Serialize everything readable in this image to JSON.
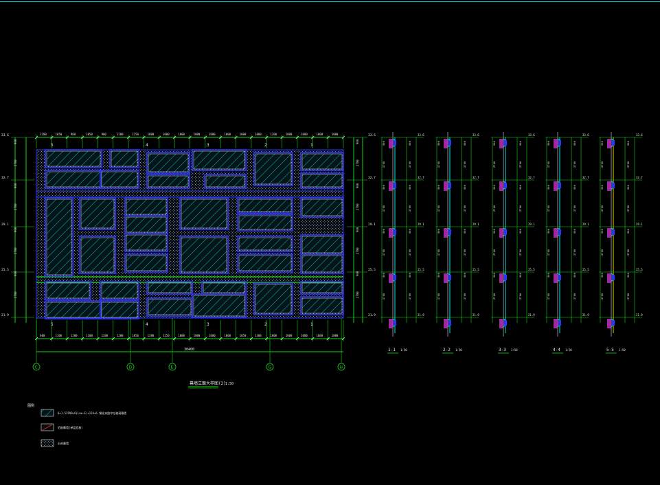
{
  "drawing": {
    "main_title": "幕墙立面大样图(2)",
    "main_scale": "1:50",
    "axes": [
      "C",
      "D",
      "E",
      "G",
      "H"
    ],
    "panel_marks_top": [
      "5",
      "4",
      "3",
      "2",
      "1"
    ],
    "panel_marks_bottom": [
      "5",
      "4",
      "3",
      "2",
      "1"
    ],
    "top_dims": [
      "1200",
      "1050",
      "900",
      "1050",
      "900",
      "1200",
      "1250",
      "1000",
      "1000",
      "1000",
      "1000",
      "1000",
      "1000",
      "1000",
      "1000",
      "1200",
      "1000",
      "1000",
      "1000",
      "1000"
    ],
    "bottom_dims": [
      "600",
      "1100",
      "1200",
      "1100",
      "1200",
      "1200",
      "1050",
      "1200",
      "1250",
      "1000",
      "1000",
      "1000",
      "1000",
      "1050",
      "1300",
      "1000",
      "1000",
      "1000",
      "1000",
      "1000"
    ],
    "overall_dim": "30400",
    "level_values": [
      "33.6",
      "32.7",
      "29.1",
      "25.5",
      "21.9"
    ],
    "left_dims": [
      "900",
      "2700",
      "900",
      "2700",
      "900",
      "2700",
      "900",
      "2700"
    ],
    "sections": [
      {
        "label": "1-1",
        "scale": "1:50"
      },
      {
        "label": "2-2",
        "scale": "1:50"
      },
      {
        "label": "3-3",
        "scale": "1:50"
      },
      {
        "label": "4-4",
        "scale": "1:50"
      },
      {
        "label": "5-5",
        "scale": "1:50"
      }
    ],
    "legend_title": "图例",
    "legend": [
      {
        "text": "6+1.52PVB+6(Low-E)+12A+6 钢化夹胶中空玻璃幕墙"
      },
      {
        "text": "铝板幕墙(单层铝板)"
      },
      {
        "text": "石材幕墙"
      }
    ],
    "colors": {
      "frame": "#2a36ff",
      "dimension": "#18d818",
      "glass_hatch": "#10b0b0",
      "stone_fill": "#7f8d8f",
      "text": "#e8e8e8",
      "cyan": "#00e0e0",
      "magenta": "#c832c8",
      "yellow": "#e8d800"
    }
  }
}
